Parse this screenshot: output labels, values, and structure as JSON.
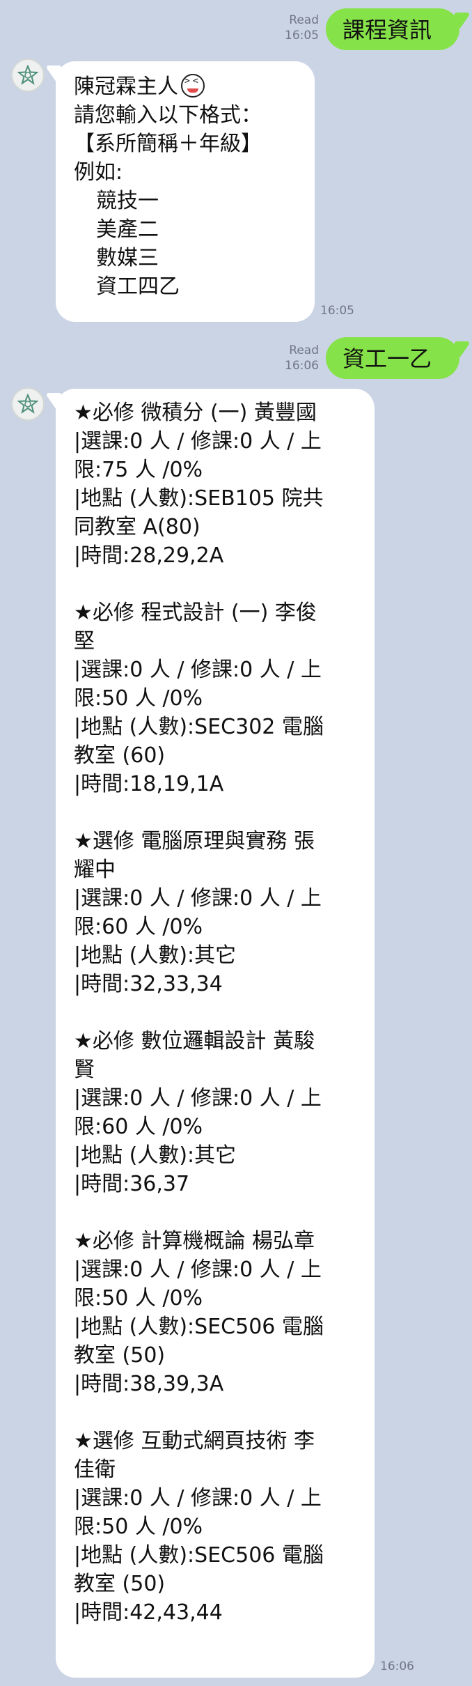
{
  "messages": {
    "out1": {
      "read": "Read",
      "time": "16:05",
      "text": "課程資訊"
    },
    "in1": {
      "time": "16:05",
      "lines": [
        "陳冠霖主人",
        "請您輸入以下格式：",
        "【系所簡稱＋年級】",
        "例如:"
      ],
      "examples": [
        "競技一",
        "美產二",
        "數媒三",
        "資工四乙"
      ]
    },
    "out2": {
      "read": "Read",
      "time": "16:06",
      "text": "資工一乙"
    },
    "in2": {
      "time": "16:06",
      "courses": [
        {
          "l1": "★必修 微積分 (一) 黃豐國",
          "l2": "|選課:0 人 / 修課:0 人 / 上",
          "l3": "限:75 人 /0%",
          "l4": "|地點 (人數):SEB105 院共",
          "l5": "同教室 A(80)",
          "l6": "|時間:28,29,2A"
        },
        {
          "l1": "★必修 程式設計 (一) 李俊",
          "l2": "堅",
          "l3": "|選課:0 人 / 修課:0 人 / 上",
          "l4": "限:50 人 /0%",
          "l5": "|地點 (人數):SEC302 電腦",
          "l6": "教室 (60)",
          "l7": "|時間:18,19,1A"
        },
        {
          "l1": "★選修 電腦原理與實務 張",
          "l2": "耀中",
          "l3": "|選課:0 人 / 修課:0 人 / 上",
          "l4": "限:60 人 /0%",
          "l5": "|地點 (人數):其它",
          "l6": "|時間:32,33,34"
        },
        {
          "l1": "★必修 數位邏輯設計 黃駿",
          "l2": "賢",
          "l3": "|選課:0 人 / 修課:0 人 / 上",
          "l4": "限:60 人 /0%",
          "l5": "|地點 (人數):其它",
          "l6": "|時間:36,37"
        },
        {
          "l1": "★必修 計算機概論 楊弘章",
          "l2": "|選課:0 人 / 修課:0 人 / 上",
          "l3": "限:50 人 /0%",
          "l4": "|地點 (人數):SEC506 電腦",
          "l5": "教室 (50)",
          "l6": "|時間:38,39,3A"
        },
        {
          "l1": "★選修 互動式網頁技術 李",
          "l2": "佳衛",
          "l3": "|選課:0 人 / 修課:0 人 / 上",
          "l4": "限:50 人 /0%",
          "l5": "|地點 (人數):SEC506 電腦",
          "l6": "教室 (50)",
          "l7": "|時間:42,43,44"
        }
      ]
    }
  },
  "icons": {
    "avatar": "bot-avatar-icon",
    "emoji": "laughing-face-emoji"
  },
  "colors": {
    "background": "#cbd4e4",
    "outgoing_bubble": "#85e249",
    "incoming_bubble": "#ffffff",
    "meta_text": "#6f7685"
  }
}
